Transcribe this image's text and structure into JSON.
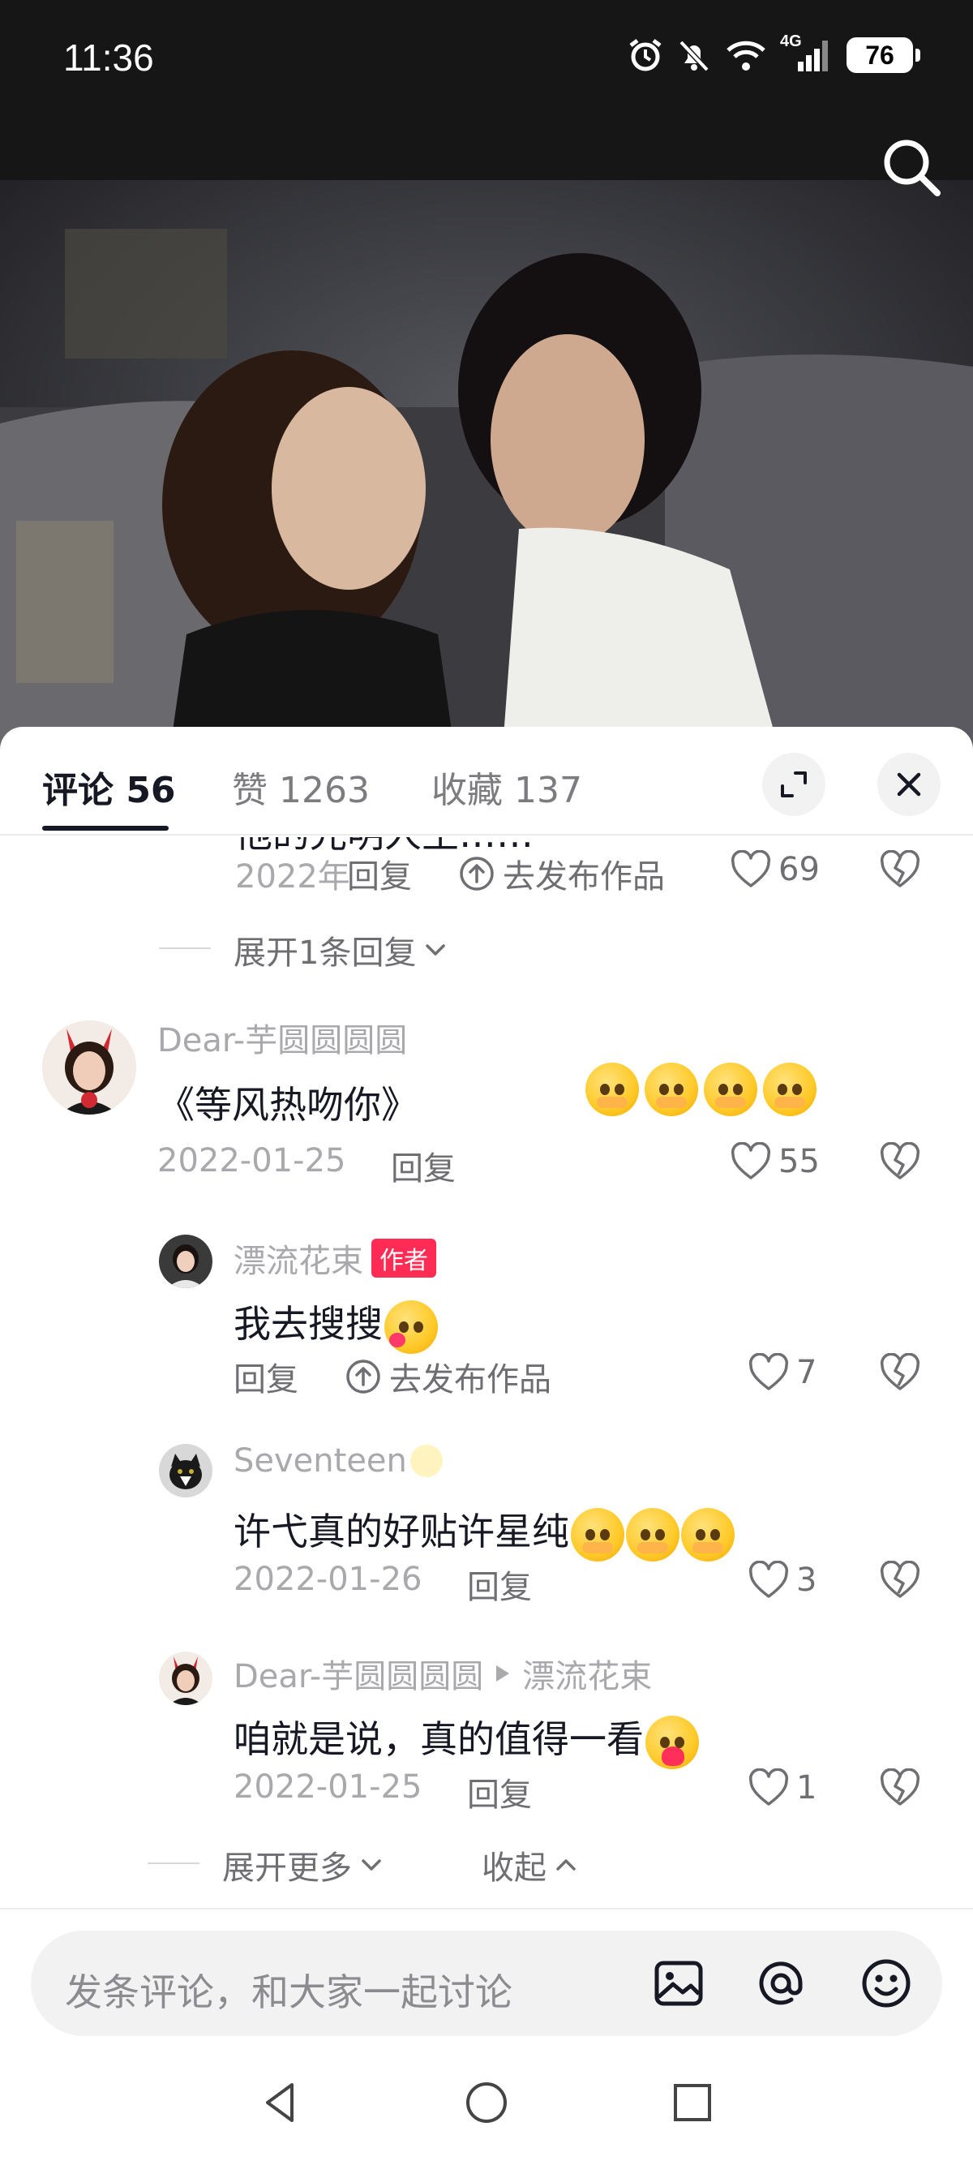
{
  "status_bar": {
    "time": "11:36",
    "battery": "76",
    "network": "4G"
  },
  "tabs": [
    {
      "label": "评论 56",
      "active": true
    },
    {
      "label": "赞 1263",
      "active": false
    },
    {
      "label": "收藏 137",
      "active": false
    }
  ],
  "comments": {
    "cut_off": {
      "text_partial": "他的光明人生……",
      "date": "2022年",
      "reply_label": "回复",
      "publish_label": "去发布作品",
      "likes": "69",
      "expand_label": "展开1条回复"
    },
    "main": {
      "user": "Dear-芋圆圆圆圆",
      "text": "《等风热吻你》",
      "date": "2022-01-25",
      "reply_label": "回复",
      "likes": "55"
    },
    "replies": [
      {
        "user": "漂流花束",
        "badge": "作者",
        "text": "我去搜搜",
        "date": "",
        "reply_label": "回复",
        "publish_label": "去发布作品",
        "likes": "7"
      },
      {
        "user": "Seventeen",
        "text": "许弋真的好贴许星纯",
        "date": "2022-01-26",
        "reply_label": "回复",
        "likes": "3"
      },
      {
        "user": "Dear-芋圆圆圆圆",
        "reply_to": "漂流花束",
        "text": "咱就是说，真的值得一看",
        "date": "2022-01-25",
        "reply_label": "回复",
        "likes": "1"
      }
    ],
    "expand_more_label": "展开更多",
    "collapse_label": "收起"
  },
  "input": {
    "placeholder": "发条评论，和大家一起讨论"
  },
  "colors": {
    "accent": "#fe2c55",
    "text": "#161823",
    "muted": "#a8a8ad",
    "panel_bg": "#ffffff"
  }
}
